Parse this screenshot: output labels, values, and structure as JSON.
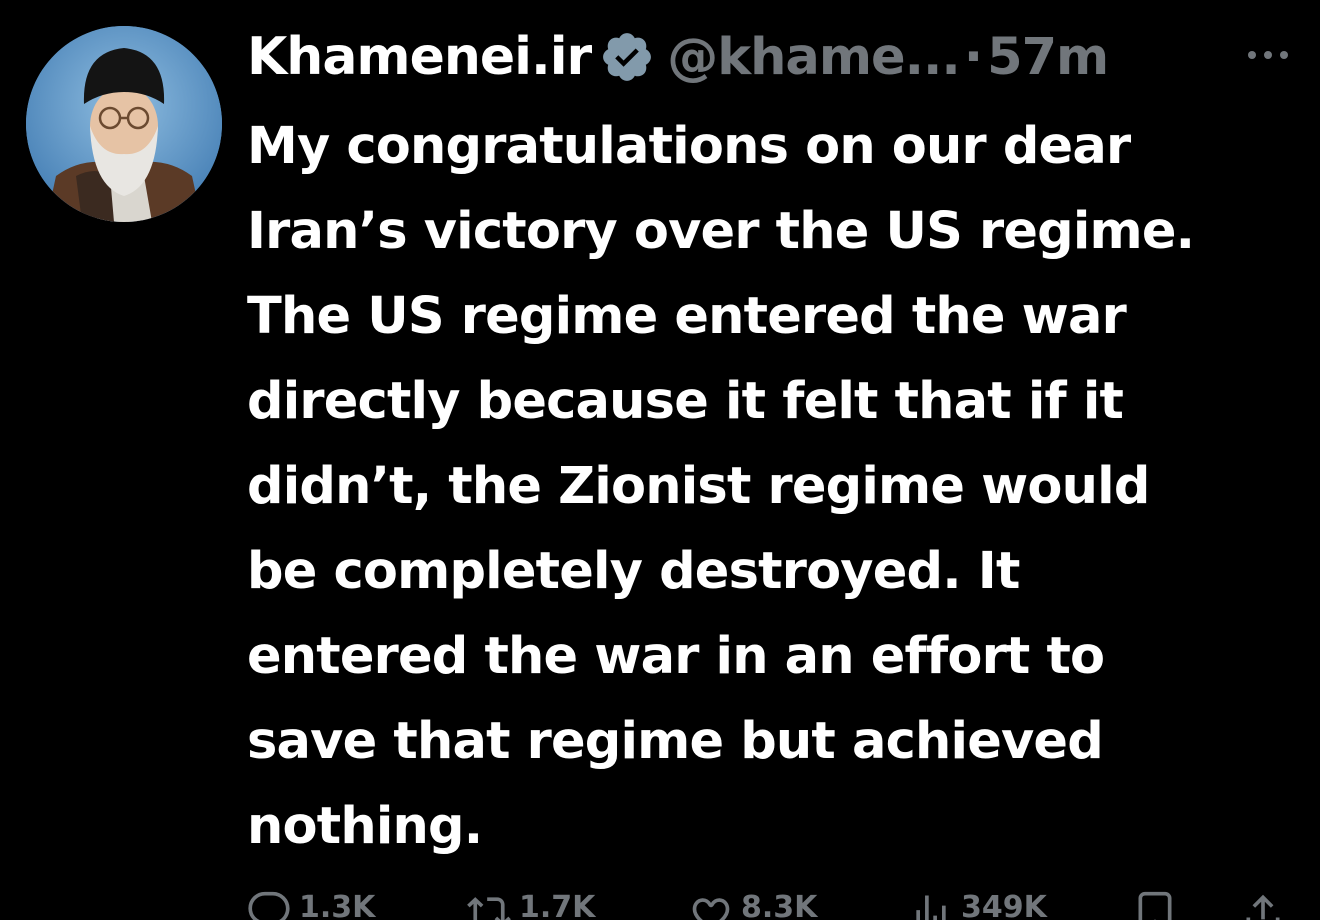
{
  "author": {
    "display_name": "Khamenei.ir",
    "handle": "@khame...",
    "separator": "·",
    "time_ago": "57m"
  },
  "tweet": {
    "lines": [
      "My congratulations on our dear",
      "Iran’s victory over the US regime.",
      "The US regime entered the war",
      "directly because it felt that if it",
      "didn’t, the Zionist regime would",
      "be completely destroyed. It",
      "entered the war in an effort to",
      "save that regime but achieved",
      "nothing."
    ]
  },
  "actions": {
    "replies": "1.3K",
    "reposts": "1.7K",
    "likes": "8.3K",
    "views": "349K"
  },
  "icons": {
    "verified": "verified-badge-icon",
    "more": "more-options-icon",
    "reply": "reply-icon",
    "repost": "repost-icon",
    "like": "heart-icon",
    "views": "views-icon",
    "bookmark": "bookmark-icon",
    "share": "share-icon"
  },
  "colors": {
    "background": "#000000",
    "text": "#ffffff",
    "secondary": "#71767b",
    "verified_badge": "#829aab"
  }
}
